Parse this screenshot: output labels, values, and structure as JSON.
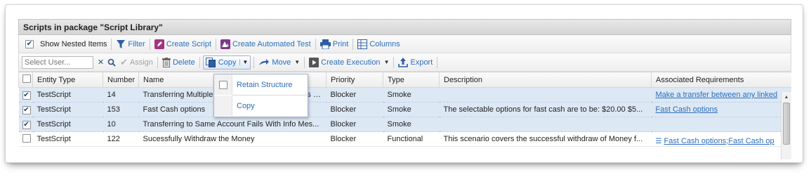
{
  "panel": {
    "title": "Scripts in package \"Script Library\""
  },
  "toolbar1": {
    "show_nested_label": "Show Nested Items",
    "show_nested_checked": true,
    "filter": "Filter",
    "create_script": "Create Script",
    "create_automated_test": "Create Automated Test",
    "print": "Print",
    "columns": "Columns"
  },
  "toolbar2": {
    "user_placeholder": "Select User...",
    "assign": "Assign",
    "delete": "Delete",
    "copy": "Copy",
    "move": "Move",
    "create_execution": "Create Execution",
    "export": "Export"
  },
  "copy_menu": {
    "retain_structure": "Retain Structure",
    "copy": "Copy"
  },
  "table": {
    "headers": {
      "entity_type": "Entity Type",
      "number": "Number",
      "name": "Name",
      "priority": "Priority",
      "type": "Type",
      "description": "Description",
      "associated_requirements": "Associated Requirements"
    },
    "rows": [
      {
        "checked": true,
        "entity_type": "TestScript",
        "number": "14",
        "name": "Transferring Multiple Amounts Between Accounts Handling...",
        "priority": "Blocker",
        "type": "Smoke",
        "description": "",
        "req": "Make a transfer between any linked",
        "req2": ""
      },
      {
        "checked": true,
        "entity_type": "TestScript",
        "number": "153",
        "name": "Fast Cash options",
        "priority": "Blocker",
        "type": "Smoke",
        "description": "The selectable options for fast cash are to be: $20.00 $5...",
        "req": "Fast Cash options",
        "req2": ""
      },
      {
        "checked": true,
        "entity_type": "TestScript",
        "number": "10",
        "name": "Transferring to Same Account Fails With Info Mes...",
        "priority": "Blocker",
        "type": "Smoke",
        "description": "",
        "req": "",
        "req2": ""
      },
      {
        "checked": false,
        "entity_type": "TestScript",
        "number": "122",
        "name": "Sucessfully Withdraw the Money",
        "priority": "Blocker",
        "type": "Functional",
        "description": "This scenario covers the successful withdraw of Money f...",
        "req": "Fast Cash options",
        "req2": "Fast Cash op"
      }
    ]
  },
  "colors": {
    "link": "#2a6ebb",
    "selected_row": "#dde8f5",
    "header_bg": "#dcdcdc"
  }
}
